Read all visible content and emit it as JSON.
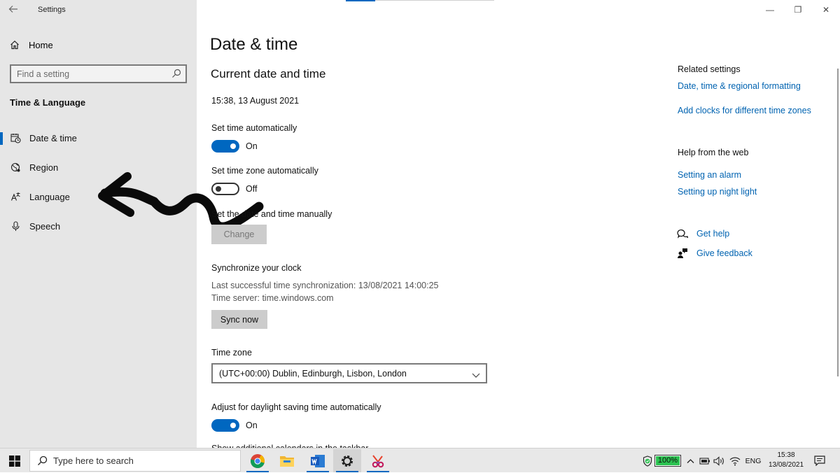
{
  "window": {
    "title": "Settings",
    "controls": {
      "minimize": "—",
      "restore": "❐",
      "close": "✕"
    }
  },
  "sidebar": {
    "home_label": "Home",
    "search_placeholder": "Find a setting",
    "section_title": "Time & Language",
    "items": [
      {
        "label": "Date & time",
        "icon": "calendar-clock-icon",
        "active": true
      },
      {
        "label": "Region",
        "icon": "globe-icon",
        "active": false
      },
      {
        "label": "Language",
        "icon": "language-icon",
        "active": false
      },
      {
        "label": "Speech",
        "icon": "microphone-icon",
        "active": false
      }
    ]
  },
  "main": {
    "page_title": "Date & time",
    "section_title": "Current date and time",
    "current_datetime": "15:38, 13 August 2021",
    "set_time_auto": {
      "label": "Set time automatically",
      "state": "On"
    },
    "set_timezone_auto": {
      "label": "Set time zone automatically",
      "state": "Off"
    },
    "manual": {
      "label": "Set the date and time manually",
      "button": "Change"
    },
    "sync": {
      "title": "Synchronize your clock",
      "last_sync": "Last successful time synchronization: 13/08/2021 14:00:25",
      "server": "Time server: time.windows.com",
      "button": "Sync now"
    },
    "timezone": {
      "label": "Time zone",
      "value": "(UTC+00:00) Dublin, Edinburgh, Lisbon, London"
    },
    "daylight": {
      "label": "Adjust for daylight saving time automatically",
      "state": "On"
    },
    "partial_next": "Show additional calendars in the taskbar"
  },
  "right": {
    "related_title": "Related settings",
    "related_links": [
      "Date, time & regional formatting",
      "Add clocks for different time zones"
    ],
    "help_title": "Help from the web",
    "help_links": [
      "Setting an alarm",
      "Setting up night light"
    ],
    "get_help": "Get help",
    "give_feedback": "Give feedback"
  },
  "taskbar": {
    "search_placeholder": "Type here to search",
    "apps": [
      "chrome-icon",
      "file-explorer-icon",
      "word-icon",
      "settings-icon",
      "snip-sketch-icon"
    ],
    "battery_percent": "100%",
    "battery_level": 1.0,
    "language": "ENG",
    "time": "15:38",
    "date": "13/08/2021"
  },
  "colors": {
    "accent": "#0067c0",
    "link": "#0063b1",
    "battery": "#2bc250"
  }
}
